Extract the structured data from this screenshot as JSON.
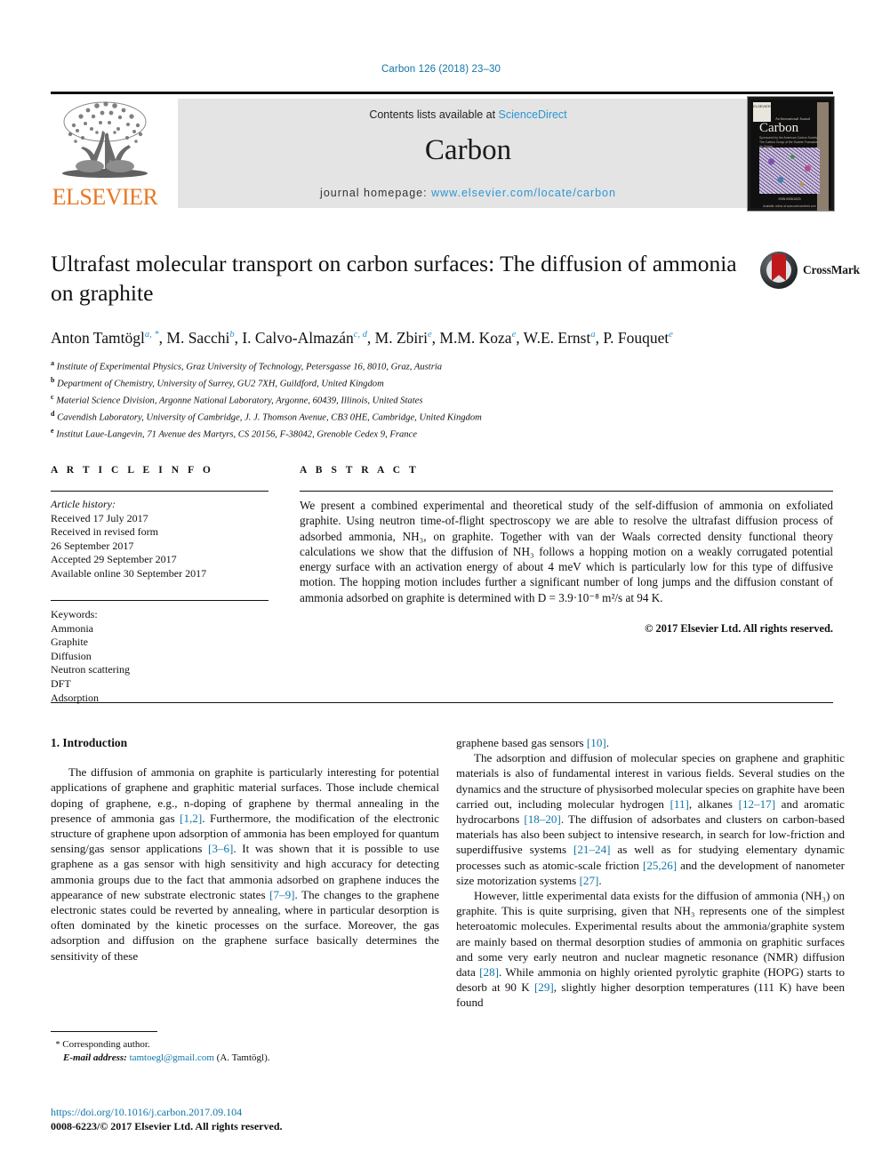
{
  "running_head": "Carbon 126 (2018) 23–30",
  "masthead": {
    "contents_prefix": "Contents lists available at ",
    "sciencedirect": "ScienceDirect",
    "journal_name": "Carbon",
    "homepage_label": "journal homepage: ",
    "homepage_url": "www.elsevier.com/locate/carbon",
    "publisher_logo_text": "ELSEVIER",
    "publisher_logo_icon": "elsevier-tree-icon",
    "cover": {
      "title": "Carbon",
      "superline": "An International Journal",
      "subtitle": "Sponsored by the American Carbon Society, The Carbon Group of the Societe Francaise de Chimie",
      "footer_line1": "ISSN 0008-6223",
      "footer_line2": "Available online at www.sciencedirect.com",
      "brandbar": "ELSEVIER"
    }
  },
  "article": {
    "title": "Ultrafast molecular transport on carbon surfaces: The diffusion of ammonia on graphite",
    "authors": [
      {
        "name": "Anton Tamtögl",
        "sup": "a, *"
      },
      {
        "name": "M. Sacchi",
        "sup": "b"
      },
      {
        "name": "I. Calvo-Almazán",
        "sup": "c, d"
      },
      {
        "name": "M. Zbiri",
        "sup": "e"
      },
      {
        "name": "M.M. Koza",
        "sup": "e"
      },
      {
        "name": "W.E. Ernst",
        "sup": "a"
      },
      {
        "name": "P. Fouquet",
        "sup": "e"
      }
    ],
    "affiliations": [
      {
        "key": "a",
        "text": "Institute of Experimental Physics, Graz University of Technology, Petersgasse 16, 8010, Graz, Austria"
      },
      {
        "key": "b",
        "text": "Department of Chemistry, University of Surrey, GU2 7XH, Guildford, United Kingdom"
      },
      {
        "key": "c",
        "text": "Material Science Division, Argonne National Laboratory, Argonne, 60439, Illinois, United States"
      },
      {
        "key": "d",
        "text": "Cavendish Laboratory, University of Cambridge, J. J. Thomson Avenue, CB3 0HE, Cambridge, United Kingdom"
      },
      {
        "key": "e",
        "text": "Institut Laue-Langevin, 71 Avenue des Martyrs, CS 20156, F-38042, Grenoble Cedex 9, France"
      }
    ],
    "crossmark_label": "CrossMark",
    "crossmark_icon": "crossmark-icon"
  },
  "article_info": {
    "heading": "A R T I C L E   I N F O",
    "history_label": "Article history:",
    "history": [
      "Received 17 July 2017",
      "Received in revised form",
      "26 September 2017",
      "Accepted 29 September 2017",
      "Available online 30 September 2017"
    ],
    "keywords_label": "Keywords:",
    "keywords": [
      "Ammonia",
      "Graphite",
      "Diffusion",
      "Neutron scattering",
      "DFT",
      "Adsorption"
    ]
  },
  "abstract": {
    "heading": "A B S T R A C T",
    "text": "We present a combined experimental and theoretical study of the self-diffusion of ammonia on exfoliated graphite. Using neutron time-of-flight spectroscopy we are able to resolve the ultrafast diffusion process of adsorbed ammonia, NH₃, on graphite. Together with van der Waals corrected density functional theory calculations we show that the diffusion of NH₃ follows a hopping motion on a weakly corrugated potential energy surface with an activation energy of about 4 meV which is particularly low for this type of diffusive motion. The hopping motion includes further a significant number of long jumps and the diffusion constant of ammonia adsorbed on graphite is determined with D = 3.9·10⁻⁸ m²/s at 94 K.",
    "copyright": "© 2017 Elsevier Ltd. All rights reserved."
  },
  "body": {
    "section_heading": "1.  Introduction",
    "left_paragraphs": [
      "The diffusion of ammonia on graphite is particularly interesting for potential applications of graphene and graphitic material surfaces. Those include chemical doping of graphene, e.g., n-doping of graphene by thermal annealing in the presence of ammonia gas [1,2]. Furthermore, the modification of the electronic structure of graphene upon adsorption of ammonia has been employed for quantum sensing/gas sensor applications [3–6]. It was shown that it is possible to use graphene as a gas sensor with high sensitivity and high accuracy for detecting ammonia groups due to the fact that ammonia adsorbed on graphene induces the appearance of new substrate electronic states [7–9]. The changes to the graphene electronic states could be reverted by annealing, where in particular desorption is often dominated by the kinetic processes on the surface. Moreover, the gas adsorption and diffusion on the graphene surface basically determines the sensitivity of these"
    ],
    "right_paragraphs": [
      "graphene based gas sensors [10].",
      "The adsorption and diffusion of molecular species on graphene and graphitic materials is also of fundamental interest in various fields. Several studies on the dynamics and the structure of physisorbed molecular species on graphite have been carried out, including molecular hydrogen [11], alkanes [12–17] and aromatic hydrocarbons [18–20]. The diffusion of adsorbates and clusters on carbon-based materials has also been subject to intensive research, in search for low-friction and superdiffusive systems [21–24] as well as for studying elementary dynamic processes such as atomic-scale friction [25,26] and the development of nanometer size motorization systems [27].",
      "However, little experimental data exists for the diffusion of ammonia (NH₃) on graphite. This is quite surprising, given that NH₃ represents one of the simplest heteroatomic molecules. Experimental results about the ammonia/graphite system are mainly based on thermal desorption studies of ammonia on graphitic surfaces and some very early neutron and nuclear magnetic resonance (NMR) diffusion data [28]. While ammonia on highly oriented pyrolytic graphite (HOPG) starts to desorb at 90 K [29], slightly higher desorption temperatures (111 K) have been found"
    ]
  },
  "footer": {
    "corresponding_marker": "*",
    "corresponding_label": "Corresponding author.",
    "email_label": "E-mail address:",
    "email": "tamtoegl@gmail.com",
    "email_owner": "(A. Tamtögl).",
    "doi": "https://doi.org/10.1016/j.carbon.2017.09.104",
    "issn_line": "0008-6223/© 2017 Elsevier Ltd. All rights reserved."
  },
  "colors": {
    "link": "#1175a8",
    "masthead_link": "#2a96d4",
    "elsevier_orange": "#e87722",
    "band_gray": "#e4e4e4"
  }
}
